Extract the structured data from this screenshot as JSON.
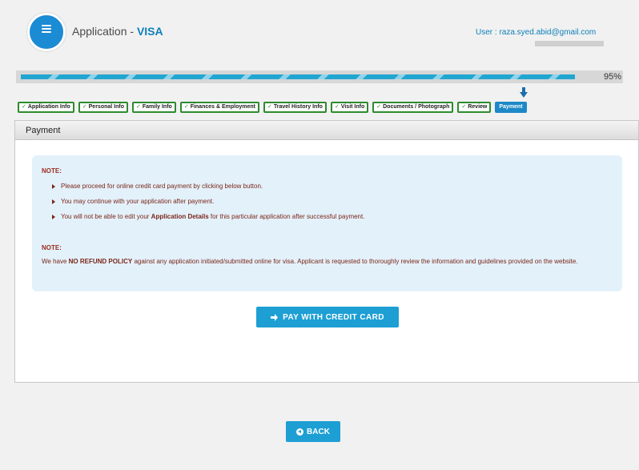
{
  "header": {
    "app_title_prefix": "Application - ",
    "app_title_bold": "VISA",
    "user_label": "User : raza.syed.abid@gmail.com"
  },
  "progress": {
    "percent": 95,
    "label": "95%"
  },
  "steps": [
    {
      "label": "Application Info",
      "done": true
    },
    {
      "label": "Personal Info",
      "done": true
    },
    {
      "label": "Family Info",
      "done": true
    },
    {
      "label": "Finances & Employment",
      "done": true
    },
    {
      "label": "Travel History Info",
      "done": true
    },
    {
      "label": "Visit Info",
      "done": true
    },
    {
      "label": "Documents / Photograph",
      "done": true
    },
    {
      "label": "Review",
      "done": true
    },
    {
      "label": "Payment",
      "done": false,
      "active": true
    }
  ],
  "panel": {
    "title": "Payment",
    "note1_title": "NOTE:",
    "bullets": [
      "Please proceed for online credit card payment by clicking below button.",
      "You may continue with your application after payment.",
      "You will not be able to edit your Application Details for this particular application after successful payment."
    ],
    "note2_title": "NOTE:",
    "note2_text": "We have NO REFUND POLICY against any application initiated/submitted online for visa. Applicant is requested to thoroughly review the information and guidelines provided on the website.",
    "pay_button": "PAY WITH CREDIT CARD"
  },
  "back_button": "BACK",
  "colors": {
    "accent": "#1d9fd4",
    "note_text": "#7a2617",
    "step_border": "#2e8b2e"
  }
}
